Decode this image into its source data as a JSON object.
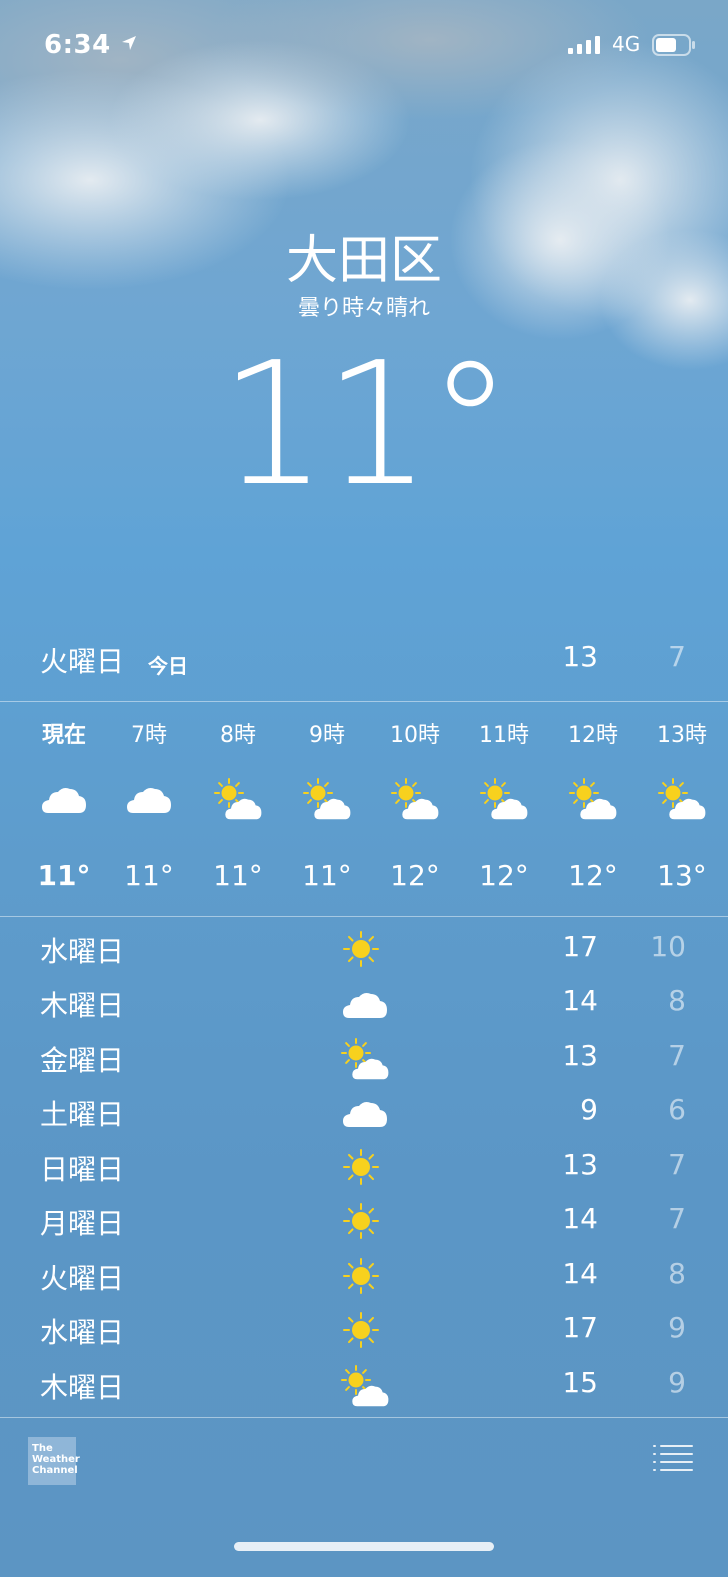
{
  "status": {
    "time": "6:34",
    "network": "4G"
  },
  "location": {
    "city": "大田区",
    "condition": "曇り時々晴れ",
    "temperature": "11°"
  },
  "today": {
    "day": "火曜日",
    "tag": "今日",
    "high": "13",
    "low": "7"
  },
  "hourly": [
    {
      "label": "現在",
      "icon": "cloud-icon",
      "temp": "11°"
    },
    {
      "label": "7時",
      "icon": "cloud-icon",
      "temp": "11°"
    },
    {
      "label": "8時",
      "icon": "partly-sunny-icon",
      "temp": "11°"
    },
    {
      "label": "9時",
      "icon": "partly-sunny-icon",
      "temp": "11°"
    },
    {
      "label": "10時",
      "icon": "partly-sunny-icon",
      "temp": "12°"
    },
    {
      "label": "11時",
      "icon": "partly-sunny-icon",
      "temp": "12°"
    },
    {
      "label": "12時",
      "icon": "partly-sunny-icon",
      "temp": "12°"
    },
    {
      "label": "13時",
      "icon": "partly-sunny-icon",
      "temp": "13°"
    }
  ],
  "daily": [
    {
      "day": "水曜日",
      "icon": "sun-icon",
      "high": "17",
      "low": "10"
    },
    {
      "day": "木曜日",
      "icon": "cloud-icon",
      "high": "14",
      "low": "8"
    },
    {
      "day": "金曜日",
      "icon": "partly-sunny-icon",
      "high": "13",
      "low": "7"
    },
    {
      "day": "土曜日",
      "icon": "cloud-icon",
      "high": "9",
      "low": "6"
    },
    {
      "day": "日曜日",
      "icon": "sun-icon",
      "high": "13",
      "low": "7"
    },
    {
      "day": "月曜日",
      "icon": "sun-icon",
      "high": "14",
      "low": "7"
    },
    {
      "day": "火曜日",
      "icon": "sun-icon",
      "high": "14",
      "low": "8"
    },
    {
      "day": "水曜日",
      "icon": "sun-icon",
      "high": "17",
      "low": "9"
    },
    {
      "day": "木曜日",
      "icon": "partly-sunny-icon",
      "high": "15",
      "low": "9"
    }
  ],
  "footer": {
    "logo_text": "The Weather Channel"
  },
  "colors": {
    "sun": "#f7d11e",
    "cloud": "#ffffff",
    "sky_top": "#7aa7c8",
    "sky_bottom": "#5c95c3"
  }
}
